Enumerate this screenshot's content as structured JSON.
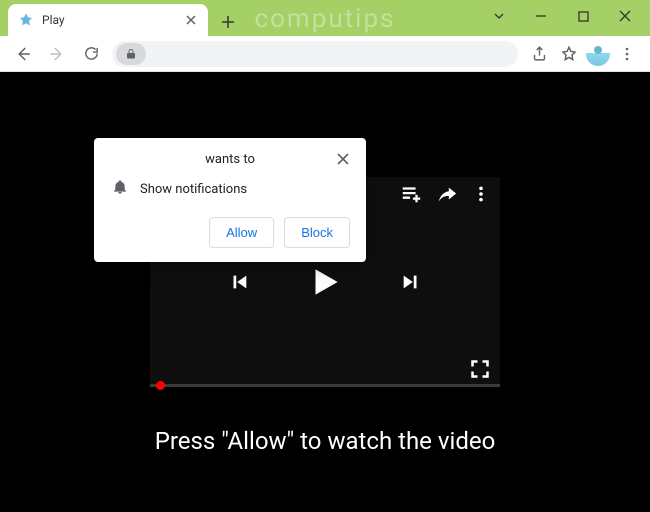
{
  "window": {
    "watermark": "computips"
  },
  "tab": {
    "title": "Play"
  },
  "permission": {
    "prompt": "wants to",
    "body": "Show notifications",
    "allow": "Allow",
    "block": "Block"
  },
  "page": {
    "caption": "Press \"Allow\" to watch the video"
  }
}
